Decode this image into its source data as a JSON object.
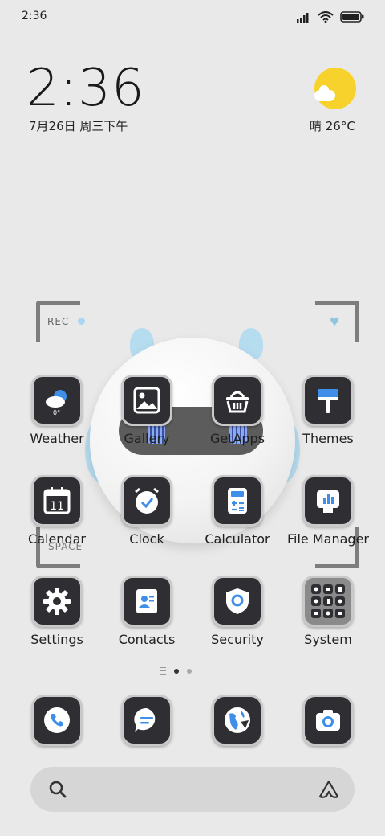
{
  "status_bar": {
    "time": "2:36",
    "icons": [
      "signal-icon",
      "wifi-icon",
      "battery-icon"
    ]
  },
  "clock_widget": {
    "time": "2:36",
    "date": "7月26日 周三下午"
  },
  "weather_widget": {
    "condition_temp": "晴 26°C",
    "icon": "sun-cloud-icon"
  },
  "decor": {
    "rec": "REC",
    "space": "SPACE"
  },
  "apps": [
    {
      "label": "Weather",
      "icon": "weather-icon"
    },
    {
      "label": "Gallery",
      "icon": "gallery-icon"
    },
    {
      "label": "GetApps",
      "icon": "basket-icon"
    },
    {
      "label": "Themes",
      "icon": "brush-icon"
    },
    {
      "label": "Calendar",
      "icon": "calendar-icon",
      "badge": "11"
    },
    {
      "label": "Clock",
      "icon": "alarm-clock-icon"
    },
    {
      "label": "Calculator",
      "icon": "calculator-icon"
    },
    {
      "label": "File Manager",
      "icon": "file-manager-icon"
    },
    {
      "label": "Settings",
      "icon": "gear-icon"
    },
    {
      "label": "Contacts",
      "icon": "contact-card-icon"
    },
    {
      "label": "Security",
      "icon": "shield-icon"
    },
    {
      "label": "System",
      "icon": "folder-grid-icon"
    }
  ],
  "weather_tile_temp": "0°",
  "dock": [
    {
      "name": "Phone",
      "icon": "phone-icon"
    },
    {
      "name": "Messages",
      "icon": "message-icon"
    },
    {
      "name": "Browser",
      "icon": "browser-icon"
    },
    {
      "name": "Camera",
      "icon": "camera-icon"
    }
  ],
  "page_indicator": {
    "pages": 2,
    "current": 1
  },
  "search": {
    "icon": "search-icon",
    "logo": "assistant-logo-icon"
  },
  "colors": {
    "accent": "#3f8fe8",
    "tile_dark": "#2f2f33",
    "background": "#e9e9e9",
    "sun": "#f7d22c"
  }
}
